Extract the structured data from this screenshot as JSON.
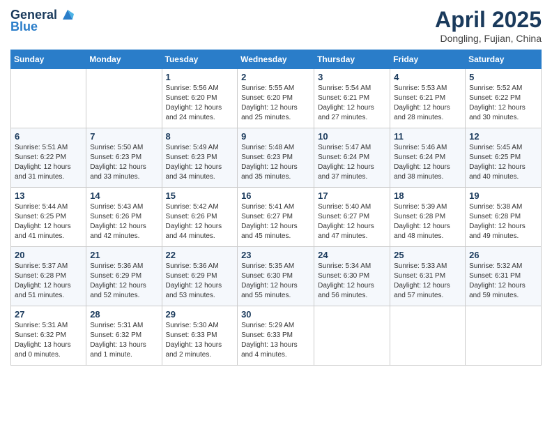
{
  "logo": {
    "general": "General",
    "blue": "Blue"
  },
  "header": {
    "title": "April 2025",
    "subtitle": "Dongling, Fujian, China"
  },
  "weekdays": [
    "Sunday",
    "Monday",
    "Tuesday",
    "Wednesday",
    "Thursday",
    "Friday",
    "Saturday"
  ],
  "weeks": [
    [
      {
        "day": "",
        "sunrise": "",
        "sunset": "",
        "daylight": ""
      },
      {
        "day": "",
        "sunrise": "",
        "sunset": "",
        "daylight": ""
      },
      {
        "day": "1",
        "sunrise": "Sunrise: 5:56 AM",
        "sunset": "Sunset: 6:20 PM",
        "daylight": "Daylight: 12 hours and 24 minutes."
      },
      {
        "day": "2",
        "sunrise": "Sunrise: 5:55 AM",
        "sunset": "Sunset: 6:20 PM",
        "daylight": "Daylight: 12 hours and 25 minutes."
      },
      {
        "day": "3",
        "sunrise": "Sunrise: 5:54 AM",
        "sunset": "Sunset: 6:21 PM",
        "daylight": "Daylight: 12 hours and 27 minutes."
      },
      {
        "day": "4",
        "sunrise": "Sunrise: 5:53 AM",
        "sunset": "Sunset: 6:21 PM",
        "daylight": "Daylight: 12 hours and 28 minutes."
      },
      {
        "day": "5",
        "sunrise": "Sunrise: 5:52 AM",
        "sunset": "Sunset: 6:22 PM",
        "daylight": "Daylight: 12 hours and 30 minutes."
      }
    ],
    [
      {
        "day": "6",
        "sunrise": "Sunrise: 5:51 AM",
        "sunset": "Sunset: 6:22 PM",
        "daylight": "Daylight: 12 hours and 31 minutes."
      },
      {
        "day": "7",
        "sunrise": "Sunrise: 5:50 AM",
        "sunset": "Sunset: 6:23 PM",
        "daylight": "Daylight: 12 hours and 33 minutes."
      },
      {
        "day": "8",
        "sunrise": "Sunrise: 5:49 AM",
        "sunset": "Sunset: 6:23 PM",
        "daylight": "Daylight: 12 hours and 34 minutes."
      },
      {
        "day": "9",
        "sunrise": "Sunrise: 5:48 AM",
        "sunset": "Sunset: 6:23 PM",
        "daylight": "Daylight: 12 hours and 35 minutes."
      },
      {
        "day": "10",
        "sunrise": "Sunrise: 5:47 AM",
        "sunset": "Sunset: 6:24 PM",
        "daylight": "Daylight: 12 hours and 37 minutes."
      },
      {
        "day": "11",
        "sunrise": "Sunrise: 5:46 AM",
        "sunset": "Sunset: 6:24 PM",
        "daylight": "Daylight: 12 hours and 38 minutes."
      },
      {
        "day": "12",
        "sunrise": "Sunrise: 5:45 AM",
        "sunset": "Sunset: 6:25 PM",
        "daylight": "Daylight: 12 hours and 40 minutes."
      }
    ],
    [
      {
        "day": "13",
        "sunrise": "Sunrise: 5:44 AM",
        "sunset": "Sunset: 6:25 PM",
        "daylight": "Daylight: 12 hours and 41 minutes."
      },
      {
        "day": "14",
        "sunrise": "Sunrise: 5:43 AM",
        "sunset": "Sunset: 6:26 PM",
        "daylight": "Daylight: 12 hours and 42 minutes."
      },
      {
        "day": "15",
        "sunrise": "Sunrise: 5:42 AM",
        "sunset": "Sunset: 6:26 PM",
        "daylight": "Daylight: 12 hours and 44 minutes."
      },
      {
        "day": "16",
        "sunrise": "Sunrise: 5:41 AM",
        "sunset": "Sunset: 6:27 PM",
        "daylight": "Daylight: 12 hours and 45 minutes."
      },
      {
        "day": "17",
        "sunrise": "Sunrise: 5:40 AM",
        "sunset": "Sunset: 6:27 PM",
        "daylight": "Daylight: 12 hours and 47 minutes."
      },
      {
        "day": "18",
        "sunrise": "Sunrise: 5:39 AM",
        "sunset": "Sunset: 6:28 PM",
        "daylight": "Daylight: 12 hours and 48 minutes."
      },
      {
        "day": "19",
        "sunrise": "Sunrise: 5:38 AM",
        "sunset": "Sunset: 6:28 PM",
        "daylight": "Daylight: 12 hours and 49 minutes."
      }
    ],
    [
      {
        "day": "20",
        "sunrise": "Sunrise: 5:37 AM",
        "sunset": "Sunset: 6:28 PM",
        "daylight": "Daylight: 12 hours and 51 minutes."
      },
      {
        "day": "21",
        "sunrise": "Sunrise: 5:36 AM",
        "sunset": "Sunset: 6:29 PM",
        "daylight": "Daylight: 12 hours and 52 minutes."
      },
      {
        "day": "22",
        "sunrise": "Sunrise: 5:36 AM",
        "sunset": "Sunset: 6:29 PM",
        "daylight": "Daylight: 12 hours and 53 minutes."
      },
      {
        "day": "23",
        "sunrise": "Sunrise: 5:35 AM",
        "sunset": "Sunset: 6:30 PM",
        "daylight": "Daylight: 12 hours and 55 minutes."
      },
      {
        "day": "24",
        "sunrise": "Sunrise: 5:34 AM",
        "sunset": "Sunset: 6:30 PM",
        "daylight": "Daylight: 12 hours and 56 minutes."
      },
      {
        "day": "25",
        "sunrise": "Sunrise: 5:33 AM",
        "sunset": "Sunset: 6:31 PM",
        "daylight": "Daylight: 12 hours and 57 minutes."
      },
      {
        "day": "26",
        "sunrise": "Sunrise: 5:32 AM",
        "sunset": "Sunset: 6:31 PM",
        "daylight": "Daylight: 12 hours and 59 minutes."
      }
    ],
    [
      {
        "day": "27",
        "sunrise": "Sunrise: 5:31 AM",
        "sunset": "Sunset: 6:32 PM",
        "daylight": "Daylight: 13 hours and 0 minutes."
      },
      {
        "day": "28",
        "sunrise": "Sunrise: 5:31 AM",
        "sunset": "Sunset: 6:32 PM",
        "daylight": "Daylight: 13 hours and 1 minute."
      },
      {
        "day": "29",
        "sunrise": "Sunrise: 5:30 AM",
        "sunset": "Sunset: 6:33 PM",
        "daylight": "Daylight: 13 hours and 2 minutes."
      },
      {
        "day": "30",
        "sunrise": "Sunrise: 5:29 AM",
        "sunset": "Sunset: 6:33 PM",
        "daylight": "Daylight: 13 hours and 4 minutes."
      },
      {
        "day": "",
        "sunrise": "",
        "sunset": "",
        "daylight": ""
      },
      {
        "day": "",
        "sunrise": "",
        "sunset": "",
        "daylight": ""
      },
      {
        "day": "",
        "sunrise": "",
        "sunset": "",
        "daylight": ""
      }
    ]
  ]
}
